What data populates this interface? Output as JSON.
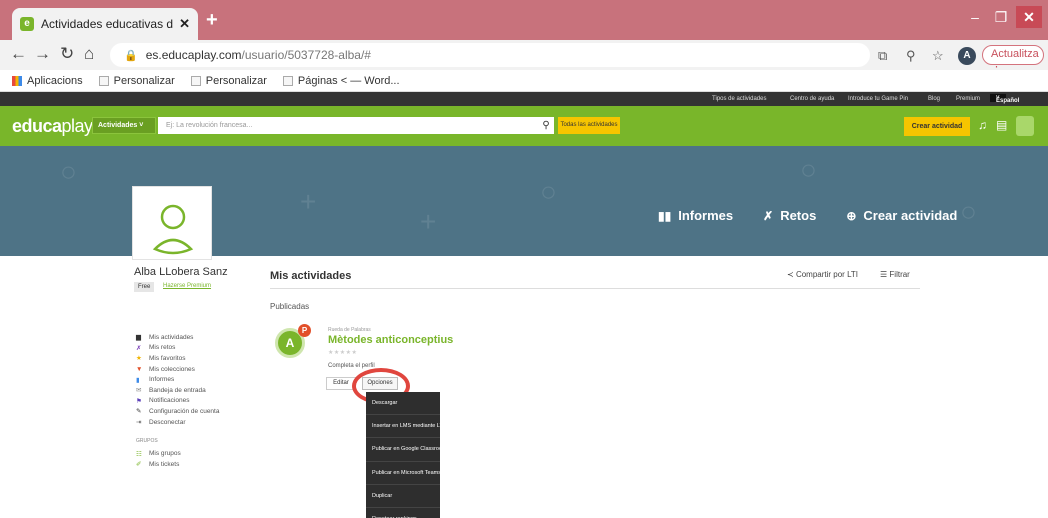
{
  "browser": {
    "tab_title": "Actividades educativas de Alba L",
    "tab_close": "✕",
    "new_tab": "+",
    "window": {
      "minimize": "–",
      "maximize": "❐",
      "close": "✕"
    },
    "url_host": "es.educaplay.com",
    "url_path": "/usuario/5037728-alba/#",
    "profile_initial": "A",
    "update_label": "Actualitza",
    "bookmarks": [
      "Aplicacions",
      "Personalizar",
      "Personalizar",
      "Páginas < — Word..."
    ]
  },
  "site": {
    "top_links": [
      "Tipos de actividades",
      "Centro de ayuda",
      "Introduce tu Game Pin",
      "Blog",
      "Premium"
    ],
    "language": "Español",
    "logo_bold": "educa",
    "logo_light": "play",
    "activities_button": "Actividades",
    "search_placeholder": "Ej: La revolución francesa...",
    "all_activities_button": "Todas las actividades",
    "create_button": "Crear actividad"
  },
  "banner": {
    "links": [
      {
        "icon": "📊",
        "label": "Informes"
      },
      {
        "icon": "⚔",
        "label": "Retos"
      },
      {
        "icon": "⊕",
        "label": "Crear actividad"
      }
    ]
  },
  "profile": {
    "name": "Alba LLobera Sanz",
    "plan": "Free",
    "premium_link": "Hazerse Premium",
    "menu": [
      {
        "icon": "▆",
        "label": "Mis actividades",
        "color": "#333333"
      },
      {
        "icon": "✗",
        "label": "Mis retos",
        "color": "#7a3fb8"
      },
      {
        "icon": "★",
        "label": "Mis favoritos",
        "color": "#f0b400"
      },
      {
        "icon": "▼",
        "label": "Mis colecciones",
        "color": "#e2502a"
      },
      {
        "icon": "▮",
        "label": "Informes",
        "color": "#3c8ae8"
      },
      {
        "icon": "✉",
        "label": "Bandeja de entrada",
        "color": "#888888"
      },
      {
        "icon": "⚑",
        "label": "Notificaciones",
        "color": "#5b3fb8"
      },
      {
        "icon": "✎",
        "label": "Configuración de cuenta",
        "color": "#333333"
      },
      {
        "icon": "⇥",
        "label": "Desconectar",
        "color": "#555555"
      }
    ],
    "groups_heading": "GRUPOS",
    "groups": [
      {
        "icon": "☷",
        "label": "Mis grupos",
        "color": "#7ab52b"
      },
      {
        "icon": "✐",
        "label": "Mis tickets",
        "color": "#7ab52b"
      }
    ]
  },
  "main": {
    "title": "Mis actividades",
    "share": "Compartir por LTI",
    "filter": "Filtrar",
    "section": "Publicadas",
    "activity": {
      "type": "Rueda de Palabras",
      "title": "Mètodes anticonceptius",
      "stars": "★★★★★",
      "status": "Completa el perfil",
      "edit": "Editar",
      "options": "Opciones",
      "badge": "P",
      "icon_letter": "A"
    },
    "options_menu": [
      "Descargar",
      "Insertar en LMS mediante LTI",
      "Publicar en Google Classroom",
      "Publicar en Microsoft Teams",
      "Duplicar",
      "Resetear rankings"
    ]
  },
  "colors": {
    "brand_green": "#79b62a",
    "accent_yellow": "#f6c500",
    "banner_blue": "#4e7386",
    "highlight_red": "#e0463e"
  }
}
